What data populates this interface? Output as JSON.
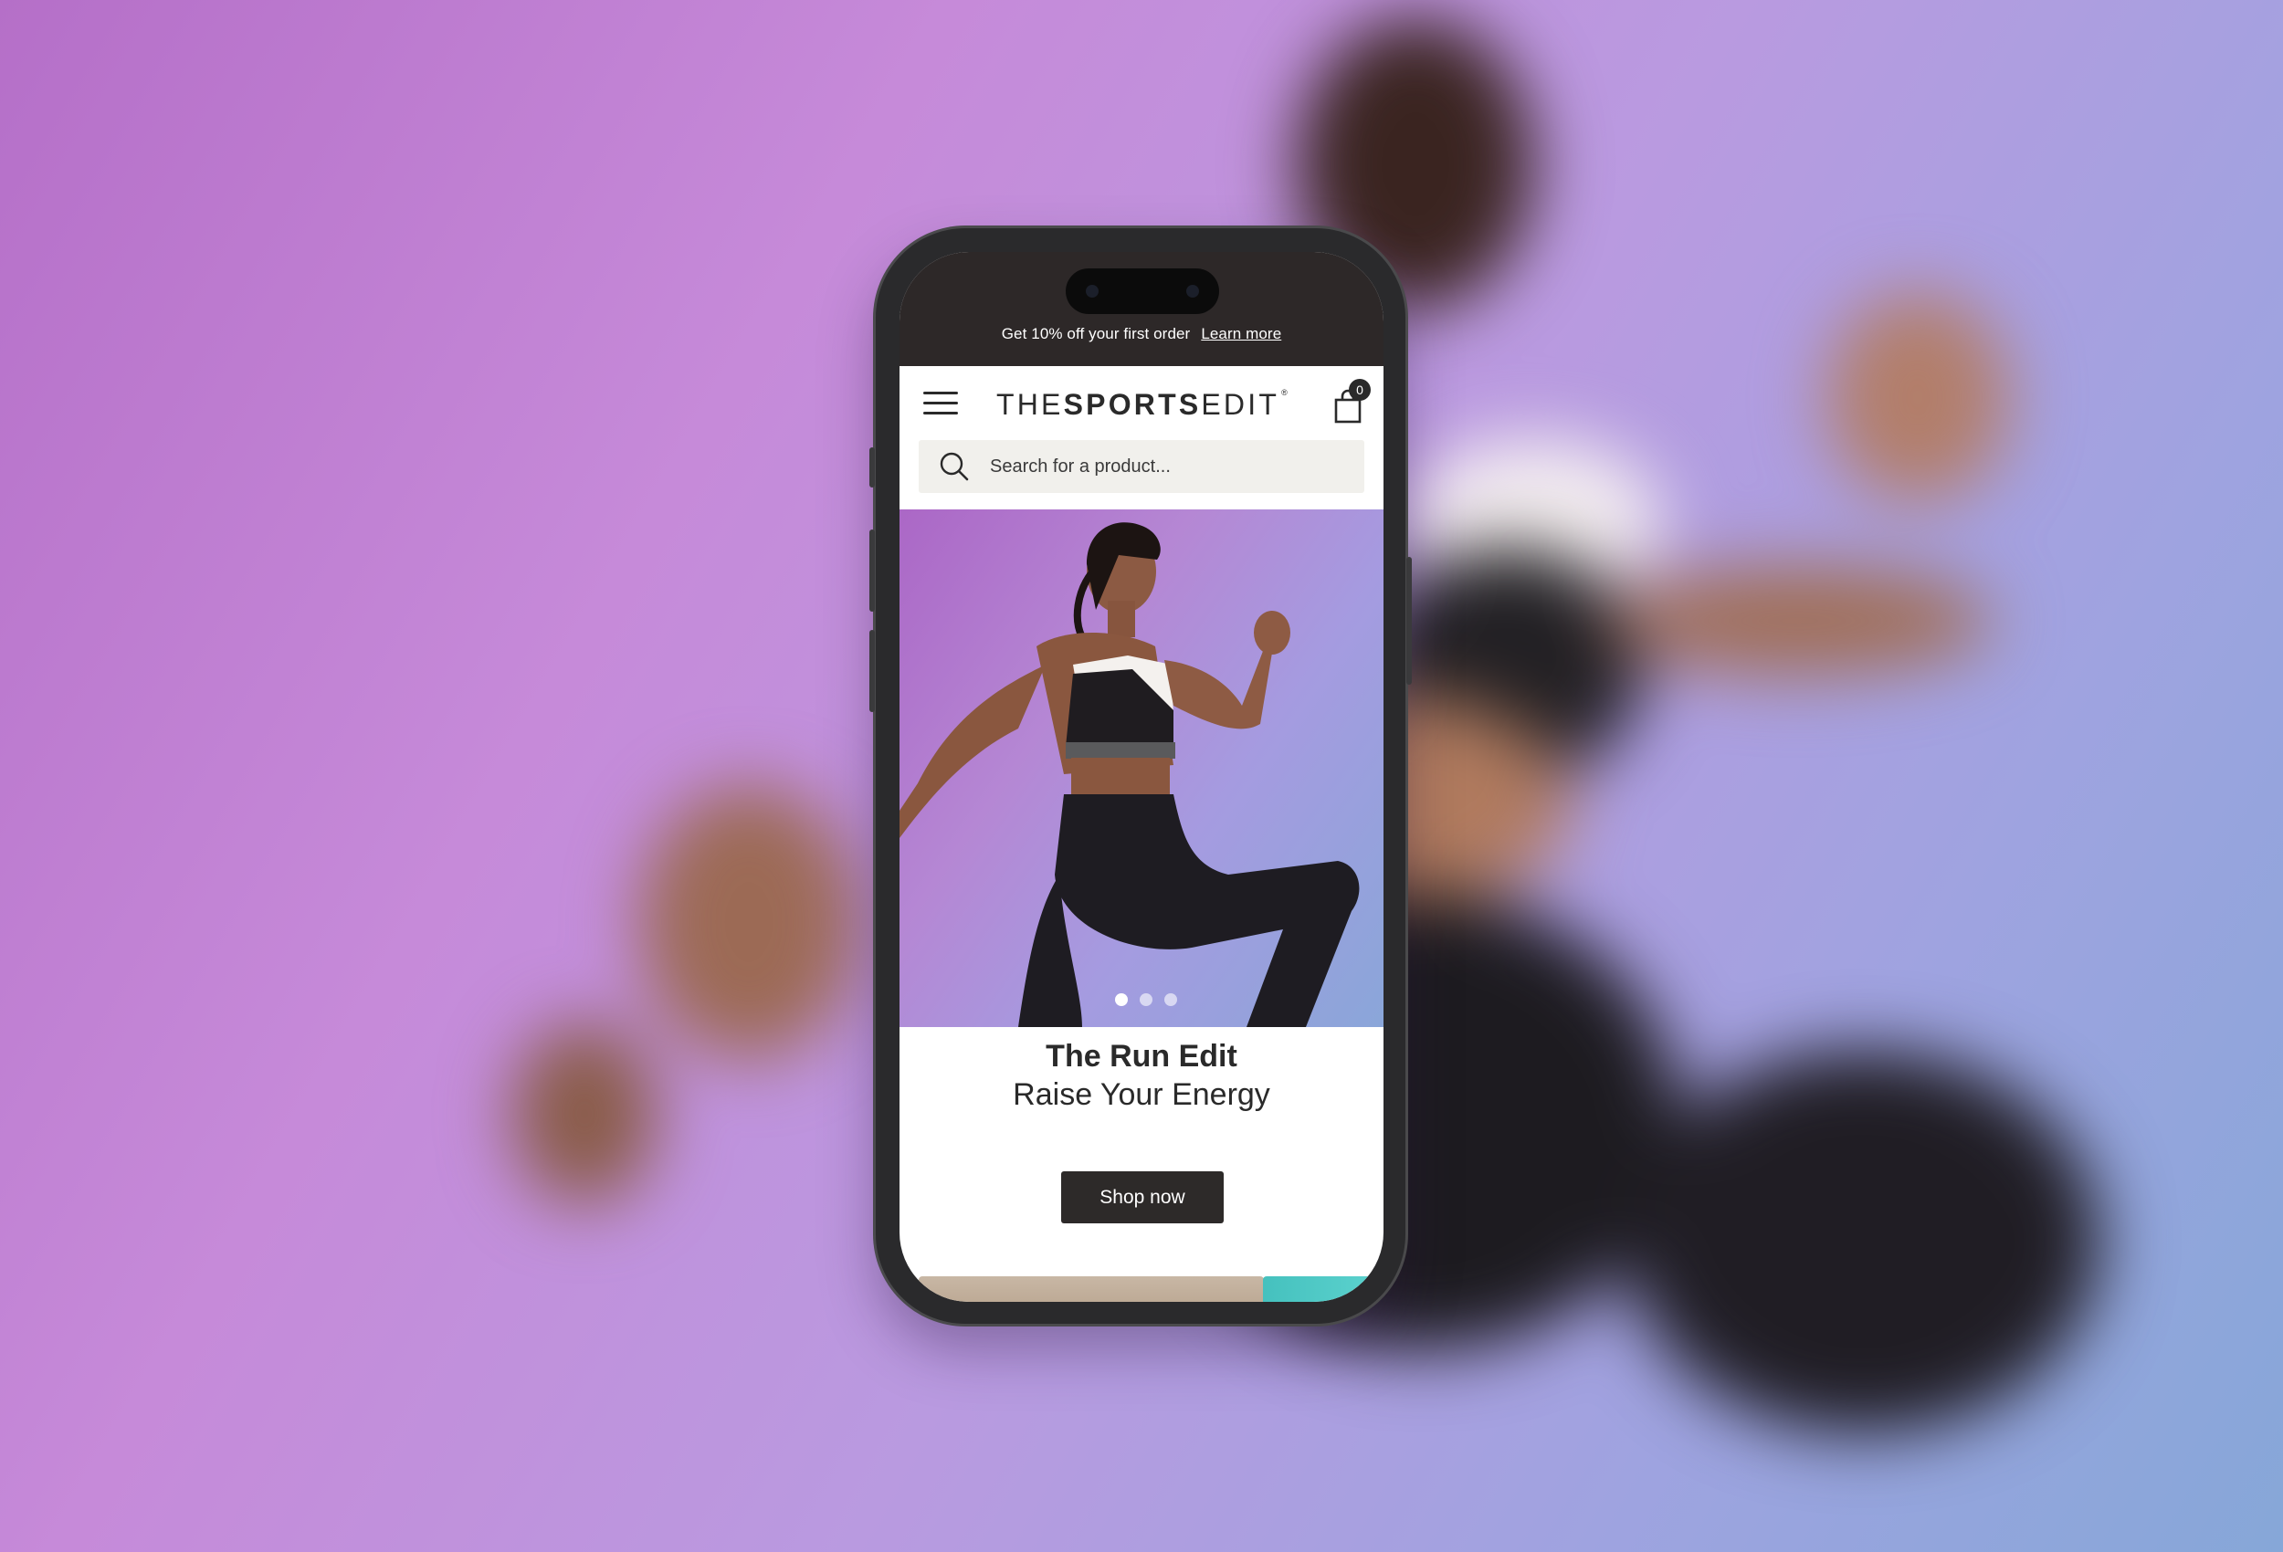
{
  "promo_bar": {
    "text": "Get 10% off your first order",
    "link_label": "Learn more"
  },
  "header": {
    "logo_light_1": "THE",
    "logo_bold": "SPORTS",
    "logo_light_2": "EDIT",
    "logo_mark": "®",
    "menu_icon": "hamburger-menu-icon",
    "cart_icon": "shopping-bag-icon",
    "cart_count": "0"
  },
  "search": {
    "placeholder": "Search for a product...",
    "icon": "search-icon"
  },
  "hero": {
    "carousel_dots": 3,
    "active_slide": 1,
    "title": "The Run Edit",
    "subtitle": "Raise Your Energy",
    "cta_label": "Shop now"
  },
  "colors": {
    "status_bar": "#2d2828",
    "button_bg": "#2d2a29",
    "search_bg": "#f1f0ec",
    "background_purple": "#b56fc8",
    "background_blue": "#86a7d8",
    "peek_card_teal": "#45c1be"
  }
}
